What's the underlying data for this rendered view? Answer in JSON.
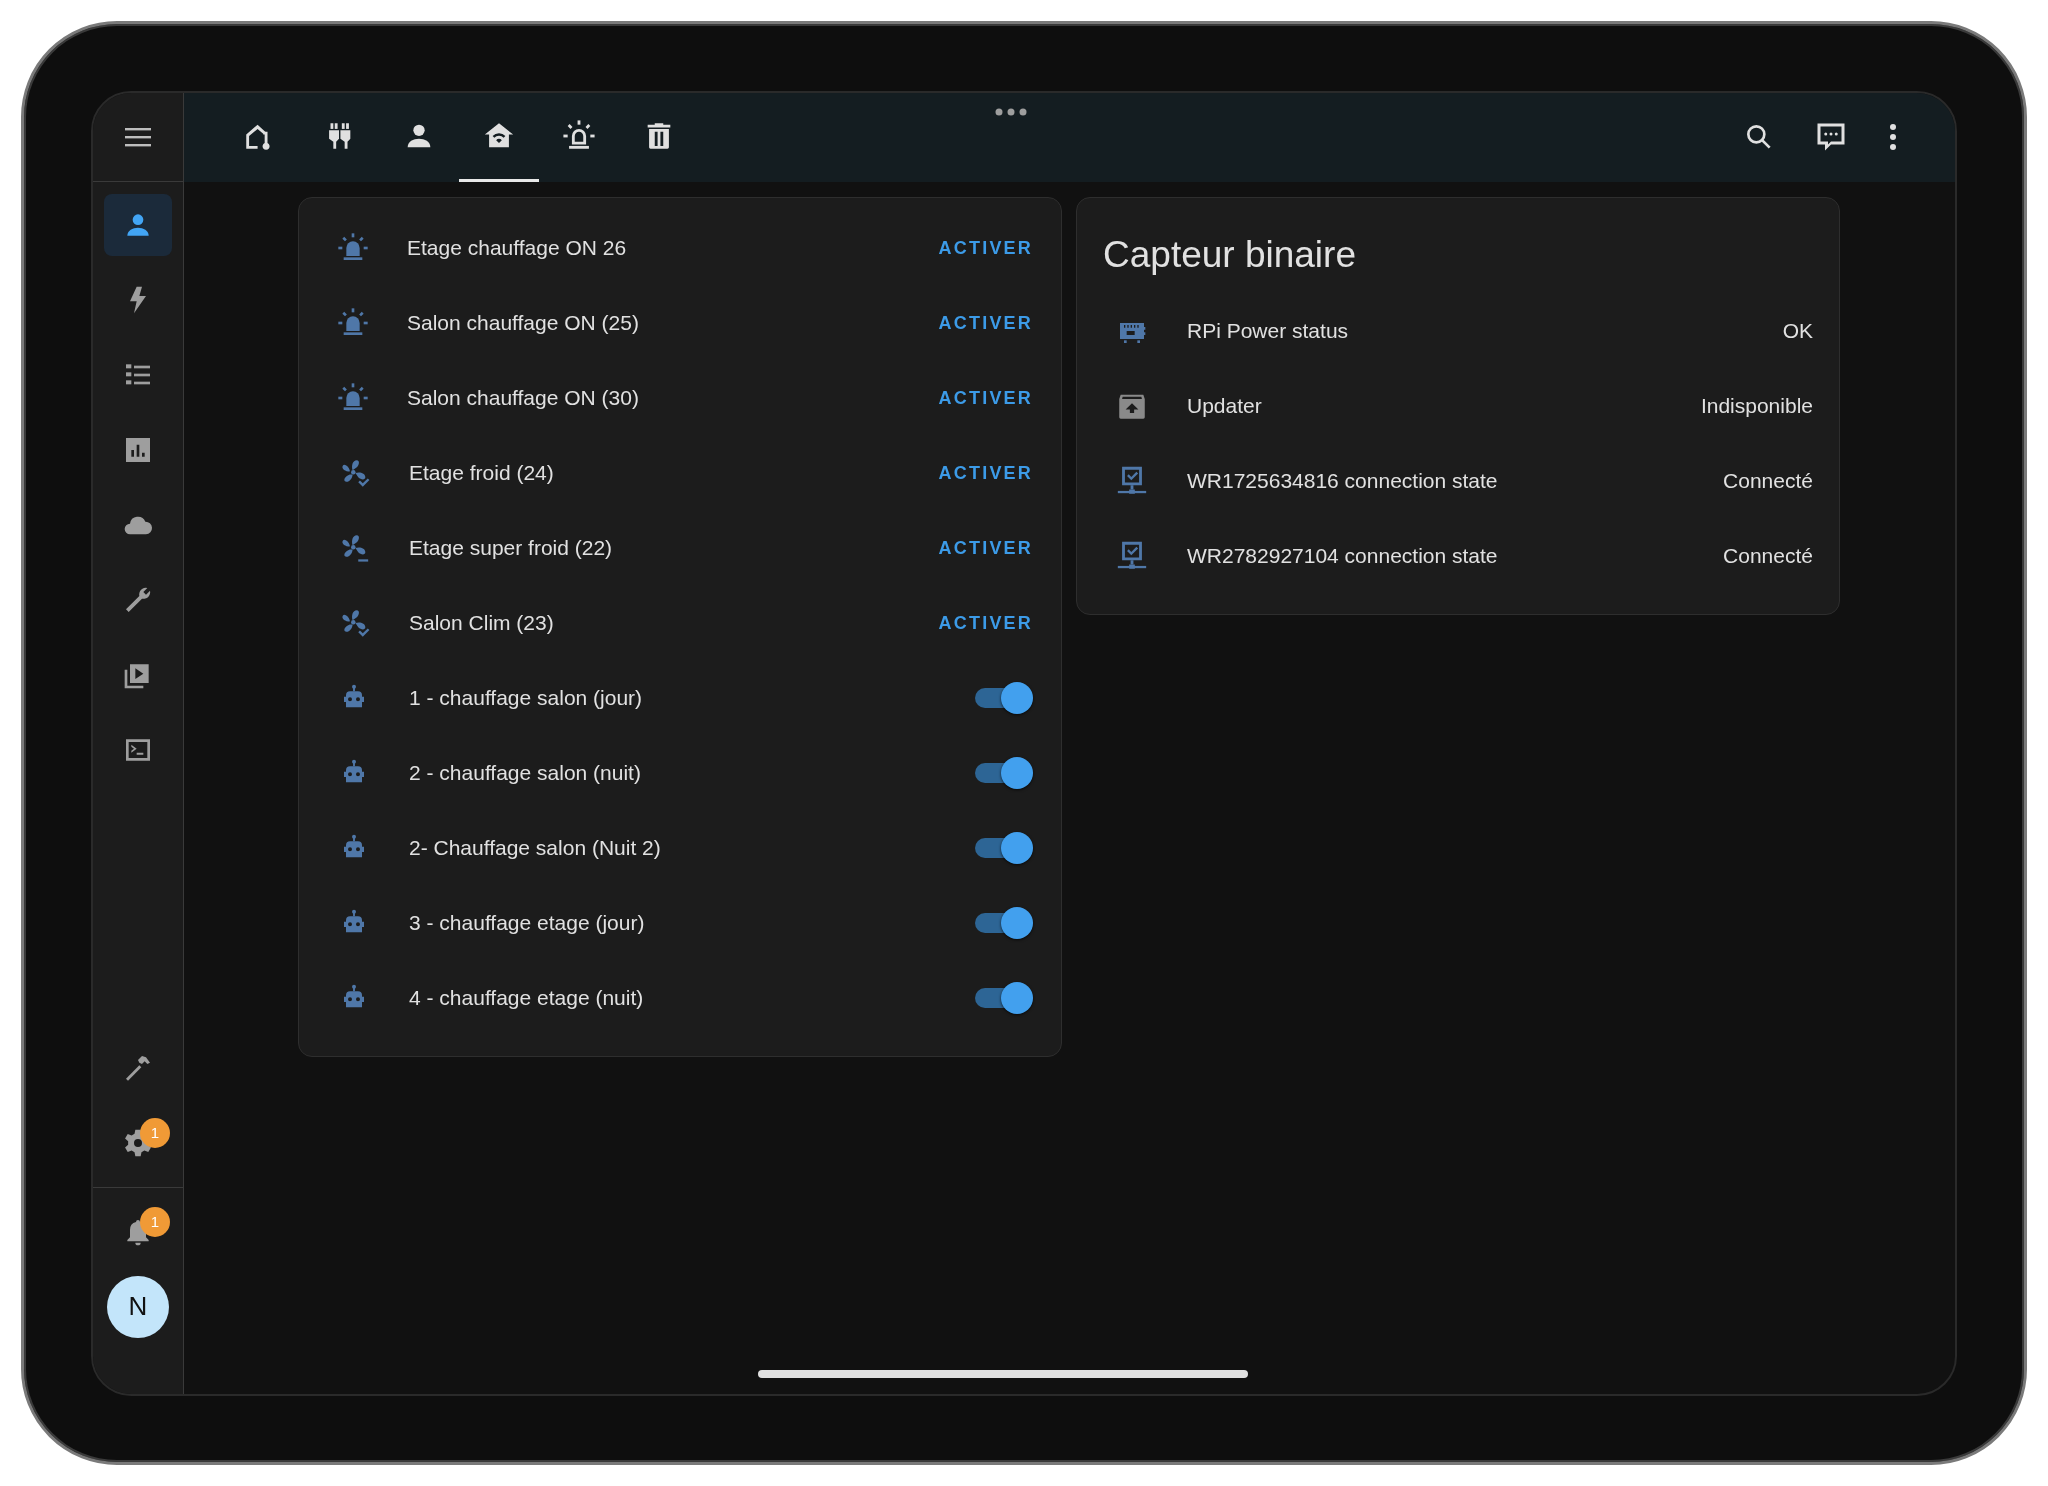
{
  "top_bar": {
    "tabs": [
      {
        "selected": false
      },
      {
        "selected": false
      },
      {
        "selected": false
      },
      {
        "selected": true
      },
      {
        "selected": false
      },
      {
        "selected": false
      }
    ]
  },
  "sidebar": {
    "items": [
      {
        "selected": true
      },
      {
        "selected": false
      },
      {
        "selected": false
      },
      {
        "selected": false
      },
      {
        "selected": false
      },
      {
        "selected": false
      },
      {
        "selected": false
      },
      {
        "selected": false
      }
    ],
    "settings_badge": "1",
    "notifications_badge": "1",
    "avatar": "N"
  },
  "scenes_card": {
    "rows": [
      {
        "kind": "button",
        "name": "Etage chauffage ON 26",
        "action": "ACTIVER"
      },
      {
        "kind": "button",
        "name": "Salon chauffage ON (25)",
        "action": "ACTIVER"
      },
      {
        "kind": "button",
        "name": "Salon chauffage ON (30)",
        "action": "ACTIVER"
      },
      {
        "kind": "button",
        "name": "Etage froid (24)",
        "action": "ACTIVER"
      },
      {
        "kind": "button",
        "name": "Etage super froid (22)",
        "action": "ACTIVER"
      },
      {
        "kind": "button",
        "name": "Salon Clim (23)",
        "action": "ACTIVER"
      },
      {
        "kind": "toggle",
        "name": "1 - chauffage salon (jour)",
        "on": true
      },
      {
        "kind": "toggle",
        "name": "2 - chauffage salon (nuit)",
        "on": true
      },
      {
        "kind": "toggle",
        "name": "2- Chauffage salon (Nuit 2)",
        "on": true
      },
      {
        "kind": "toggle",
        "name": "3 - chauffage etage (jour)",
        "on": true
      },
      {
        "kind": "toggle",
        "name": "4 - chauffage etage (nuit)",
        "on": true
      }
    ]
  },
  "binary_sensor_card": {
    "title": "Capteur binaire",
    "rows": [
      {
        "name": "RPi Power status",
        "state": "OK"
      },
      {
        "name": "Updater",
        "state": "Indisponible"
      },
      {
        "name": "WR1725634816 connection state",
        "state": "Connecté"
      },
      {
        "name": "WR2782927104 connection state",
        "state": "Connecté"
      }
    ]
  }
}
